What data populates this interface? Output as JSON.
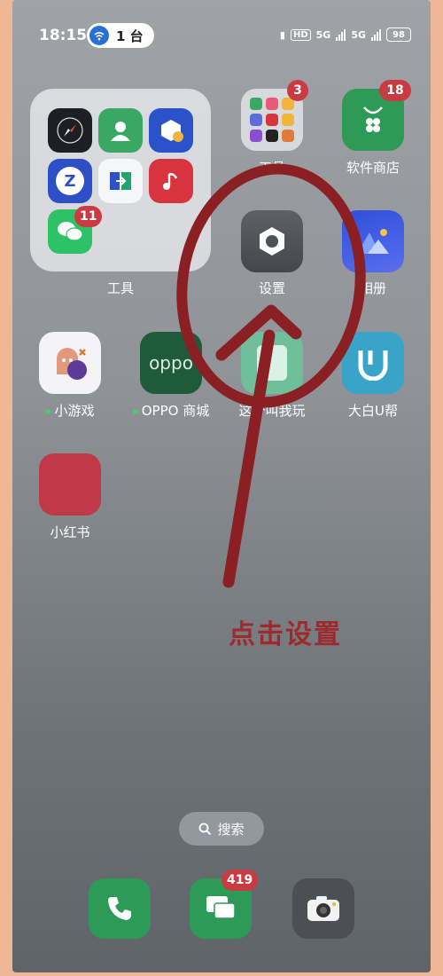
{
  "status_bar": {
    "time": "18:15",
    "cast_count": "1 台",
    "hd_label": "HD",
    "net1": "5G",
    "net2": "5G",
    "battery": "98"
  },
  "folder_left": {
    "label": "工具",
    "wechat_badge": "11"
  },
  "folder_small": {
    "label": "工具",
    "badge": "3"
  },
  "apps": {
    "store": {
      "label": "软件商店",
      "badge": "18"
    },
    "settings": {
      "label": "设置"
    },
    "album": {
      "label": "相册"
    },
    "game": {
      "label": "小游戏"
    },
    "oppo_store": {
      "label": "OPPO 商城",
      "logo": "oppo"
    },
    "hidden_app": {
      "label": "这个叫我玩"
    },
    "dabai": {
      "label": "大白U帮"
    },
    "xhs": {
      "label": "小红书"
    }
  },
  "annotation": "点击设置",
  "search": {
    "label": "搜索"
  },
  "dock": {
    "messages_badge": "419"
  },
  "colors": {
    "annotation_red": "#9e2a2e",
    "badge_red": "#c93b43"
  }
}
